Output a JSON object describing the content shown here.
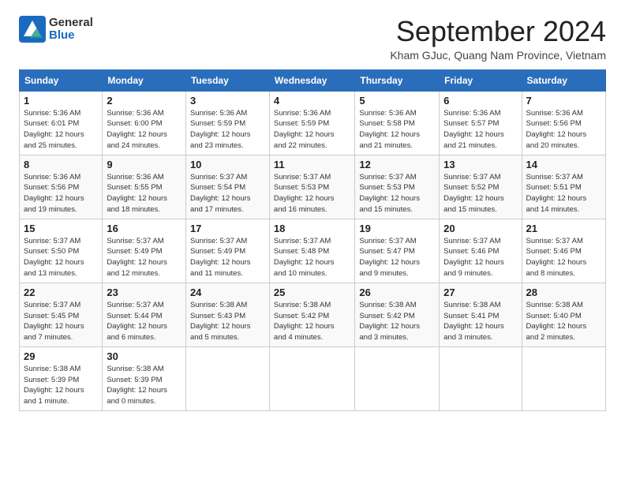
{
  "logo": {
    "text1": "General",
    "text2": "Blue"
  },
  "title": "September 2024",
  "subtitle": "Kham GJuc, Quang Nam Province, Vietnam",
  "days_of_week": [
    "Sunday",
    "Monday",
    "Tuesday",
    "Wednesday",
    "Thursday",
    "Friday",
    "Saturday"
  ],
  "weeks": [
    [
      {
        "num": "1",
        "info": "Sunrise: 5:36 AM\nSunset: 6:01 PM\nDaylight: 12 hours\nand 25 minutes."
      },
      {
        "num": "2",
        "info": "Sunrise: 5:36 AM\nSunset: 6:00 PM\nDaylight: 12 hours\nand 24 minutes."
      },
      {
        "num": "3",
        "info": "Sunrise: 5:36 AM\nSunset: 5:59 PM\nDaylight: 12 hours\nand 23 minutes."
      },
      {
        "num": "4",
        "info": "Sunrise: 5:36 AM\nSunset: 5:59 PM\nDaylight: 12 hours\nand 22 minutes."
      },
      {
        "num": "5",
        "info": "Sunrise: 5:36 AM\nSunset: 5:58 PM\nDaylight: 12 hours\nand 21 minutes."
      },
      {
        "num": "6",
        "info": "Sunrise: 5:36 AM\nSunset: 5:57 PM\nDaylight: 12 hours\nand 21 minutes."
      },
      {
        "num": "7",
        "info": "Sunrise: 5:36 AM\nSunset: 5:56 PM\nDaylight: 12 hours\nand 20 minutes."
      }
    ],
    [
      {
        "num": "8",
        "info": "Sunrise: 5:36 AM\nSunset: 5:56 PM\nDaylight: 12 hours\nand 19 minutes."
      },
      {
        "num": "9",
        "info": "Sunrise: 5:36 AM\nSunset: 5:55 PM\nDaylight: 12 hours\nand 18 minutes."
      },
      {
        "num": "10",
        "info": "Sunrise: 5:37 AM\nSunset: 5:54 PM\nDaylight: 12 hours\nand 17 minutes."
      },
      {
        "num": "11",
        "info": "Sunrise: 5:37 AM\nSunset: 5:53 PM\nDaylight: 12 hours\nand 16 minutes."
      },
      {
        "num": "12",
        "info": "Sunrise: 5:37 AM\nSunset: 5:53 PM\nDaylight: 12 hours\nand 15 minutes."
      },
      {
        "num": "13",
        "info": "Sunrise: 5:37 AM\nSunset: 5:52 PM\nDaylight: 12 hours\nand 15 minutes."
      },
      {
        "num": "14",
        "info": "Sunrise: 5:37 AM\nSunset: 5:51 PM\nDaylight: 12 hours\nand 14 minutes."
      }
    ],
    [
      {
        "num": "15",
        "info": "Sunrise: 5:37 AM\nSunset: 5:50 PM\nDaylight: 12 hours\nand 13 minutes."
      },
      {
        "num": "16",
        "info": "Sunrise: 5:37 AM\nSunset: 5:49 PM\nDaylight: 12 hours\nand 12 minutes."
      },
      {
        "num": "17",
        "info": "Sunrise: 5:37 AM\nSunset: 5:49 PM\nDaylight: 12 hours\nand 11 minutes."
      },
      {
        "num": "18",
        "info": "Sunrise: 5:37 AM\nSunset: 5:48 PM\nDaylight: 12 hours\nand 10 minutes."
      },
      {
        "num": "19",
        "info": "Sunrise: 5:37 AM\nSunset: 5:47 PM\nDaylight: 12 hours\nand 9 minutes."
      },
      {
        "num": "20",
        "info": "Sunrise: 5:37 AM\nSunset: 5:46 PM\nDaylight: 12 hours\nand 9 minutes."
      },
      {
        "num": "21",
        "info": "Sunrise: 5:37 AM\nSunset: 5:46 PM\nDaylight: 12 hours\nand 8 minutes."
      }
    ],
    [
      {
        "num": "22",
        "info": "Sunrise: 5:37 AM\nSunset: 5:45 PM\nDaylight: 12 hours\nand 7 minutes."
      },
      {
        "num": "23",
        "info": "Sunrise: 5:37 AM\nSunset: 5:44 PM\nDaylight: 12 hours\nand 6 minutes."
      },
      {
        "num": "24",
        "info": "Sunrise: 5:38 AM\nSunset: 5:43 PM\nDaylight: 12 hours\nand 5 minutes."
      },
      {
        "num": "25",
        "info": "Sunrise: 5:38 AM\nSunset: 5:42 PM\nDaylight: 12 hours\nand 4 minutes."
      },
      {
        "num": "26",
        "info": "Sunrise: 5:38 AM\nSunset: 5:42 PM\nDaylight: 12 hours\nand 3 minutes."
      },
      {
        "num": "27",
        "info": "Sunrise: 5:38 AM\nSunset: 5:41 PM\nDaylight: 12 hours\nand 3 minutes."
      },
      {
        "num": "28",
        "info": "Sunrise: 5:38 AM\nSunset: 5:40 PM\nDaylight: 12 hours\nand 2 minutes."
      }
    ],
    [
      {
        "num": "29",
        "info": "Sunrise: 5:38 AM\nSunset: 5:39 PM\nDaylight: 12 hours\nand 1 minute."
      },
      {
        "num": "30",
        "info": "Sunrise: 5:38 AM\nSunset: 5:39 PM\nDaylight: 12 hours\nand 0 minutes."
      },
      null,
      null,
      null,
      null,
      null
    ]
  ]
}
